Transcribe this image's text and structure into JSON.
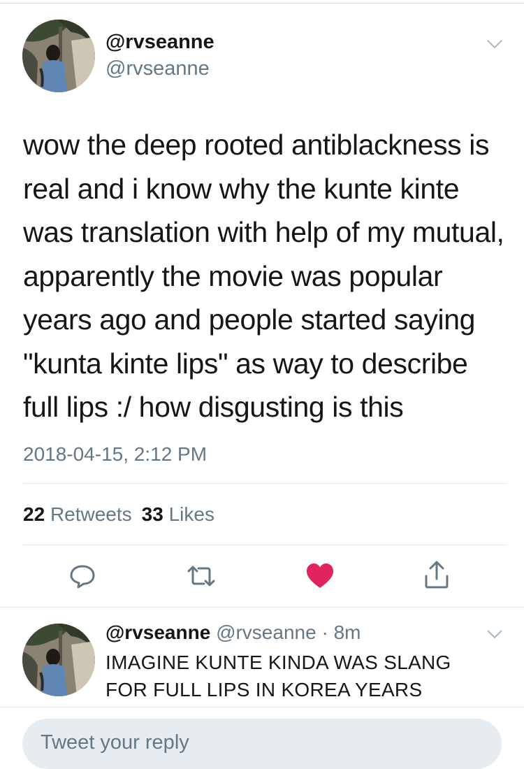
{
  "colors": {
    "text": "#14171a",
    "secondary": "#657786",
    "divider": "#e1e8ed",
    "like_red": "#e0245e",
    "reply_box_bg": "#e6ecf0"
  },
  "tweet": {
    "display_name": "@rvseanne",
    "handle": "@rvseanne",
    "text_lines": [
      "wow the deep rooted antiblackness is",
      "real and i know why the kunte kinte",
      "was translation with help of my mutual,",
      "apparently the movie was popular",
      "years ago and people started saying",
      "\"kunta kinte lips\" as way to describe",
      "full lips :/ how disgusting is this"
    ],
    "timestamp": "2018-04-15, 2:12 PM",
    "retweets_count": "22",
    "retweets_label": "Retweets",
    "likes_count": "33",
    "likes_label": "Likes",
    "liked": true
  },
  "icons": {
    "avatar": "avatar-photo",
    "menu": "chevron-down-icon",
    "reply": "reply-icon",
    "retweet": "retweet-icon",
    "like": "heart-icon",
    "share": "share-icon"
  },
  "reply": {
    "display_name": "@rvseanne",
    "handle": "@rvseanne",
    "separator": "·",
    "time": "8m",
    "text_lines": [
      "IMAGINE KUNTE KINDA WAS SLANG",
      "FOR FULL LIPS IN KOREA YEARS"
    ]
  },
  "compose": {
    "placeholder": "Tweet your reply"
  }
}
